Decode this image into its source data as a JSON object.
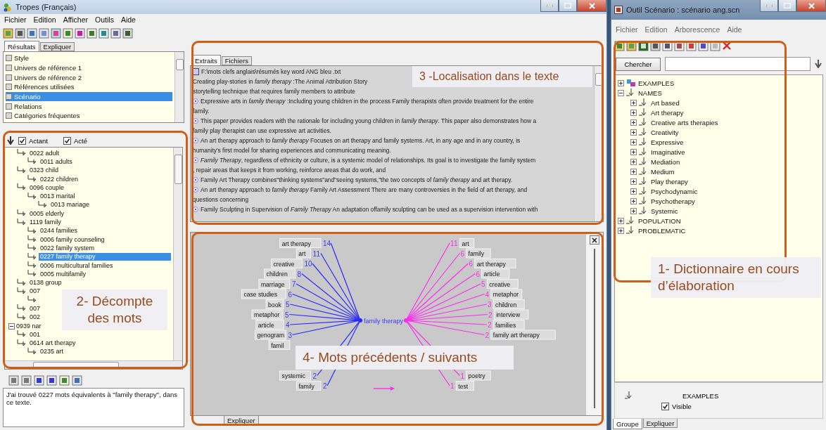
{
  "left_window": {
    "title": "Tropes (Français)",
    "menu": [
      "Fichier",
      "Edition",
      "Afficher",
      "Outils",
      "Aide"
    ],
    "results_tabs": [
      {
        "label": "Résultats",
        "selected": true
      },
      {
        "label": "Expliquer",
        "selected": false
      }
    ],
    "results_list": [
      {
        "label": "Style",
        "selected": false
      },
      {
        "label": "Univers de référence 1",
        "selected": false
      },
      {
        "label": "Univers de référence 2",
        "selected": false
      },
      {
        "label": "Références utilisées",
        "selected": false
      },
      {
        "label": "Scénario",
        "selected": true
      },
      {
        "label": "Relations",
        "selected": false
      },
      {
        "label": "Catégories fréquentes",
        "selected": false
      }
    ],
    "filters": [
      {
        "label": "Actant",
        "checked": true
      },
      {
        "label": "Acté",
        "checked": true
      }
    ],
    "tree": [
      {
        "children": [
          {
            "label": "0022 adult",
            "selected": false,
            "children": [
              {
                "label": "0011 adults",
                "selected": false
              }
            ]
          },
          {
            "label": "0323 child",
            "selected": false,
            "children": [
              {
                "label": "0222 children",
                "selected": false
              }
            ]
          },
          {
            "label": "0096 couple",
            "selected": false,
            "children": [
              {
                "label": "0013 marital",
                "selected": false,
                "children": [
                  {
                    "label": "0013 mariage",
                    "selected": false
                  }
                ]
              }
            ]
          },
          {
            "label": "0005 elderly",
            "selected": false
          },
          {
            "label": "1119 family",
            "selected": false,
            "children": [
              {
                "label": "0244 families",
                "selected": false
              },
              {
                "label": "0006 family counseling",
                "selected": false
              },
              {
                "label": "0022 family system",
                "selected": false
              },
              {
                "label": "0227 family therapy",
                "selected": true
              },
              {
                "label": "0006 multicultural families",
                "selected": false
              },
              {
                "label": "0005 multifamily",
                "selected": false
              }
            ]
          },
          {
            "label": "0138 group",
            "selected": false
          },
          {
            "label": "007",
            "selected": false,
            "children": [
              {
                "kind": "branch"
              }
            ]
          },
          {
            "label": "007",
            "selected": false
          },
          {
            "label": "002",
            "selected": false
          }
        ]
      },
      {
        "label": "0939 nar",
        "selected": false,
        "children": [
          {
            "label": "001",
            "selected": false
          },
          {
            "label": "0614 art therapy",
            "selected": false,
            "children": [
              {
                "label": "0235 art",
                "selected": false
              }
            ]
          }
        ]
      }
    ],
    "message": "J'ai trouvé 0227 mots équivalents à \"family therapy\", dans ce texte.",
    "text_tabs": [
      {
        "label": "Extraits",
        "selected": true
      },
      {
        "label": "Fichiers",
        "selected": false
      }
    ],
    "extract_lines": [
      {
        "kind": "file",
        "text": "F:\\mots clefs anglais\\résumés key word ANG bleu .txt"
      },
      {
        "kind": "plain",
        "text": "Creating play-stories in *family therapy* :The Animal Attribution Story"
      },
      {
        "kind": "plain",
        "text": "storytelling technique that requires family members to attribute"
      },
      {
        "kind": "bullet",
        "text": "Expressive arts in *family therapy* :Including young children in the process Family therapists often provide treatment for the entire"
      },
      {
        "kind": "plain",
        "text": "family."
      },
      {
        "kind": "bullet",
        "text": "This paper provides readers with the rationale for including young children in *family therapy*. This paper also demonstrates how a"
      },
      {
        "kind": "plain",
        "text": "family play therapist can use expressive art activities."
      },
      {
        "kind": "bullet",
        "text": "An art therapy approach to *family therapy* Focuses on art therapy and family systems. Art, in any age and in any country, is"
      },
      {
        "kind": "plain",
        "text": "humanity's first model for sharing experiences and communicating meaning."
      },
      {
        "kind": "bullet",
        "text": "*Family Therapy*, regardless of ethnicity or culture, is a systemic model of relationships. Its goal is to investigate the family system"
      },
      {
        "kind": "plain",
        "text": ", repair areas that keeps it from working, reinforce areas that do work, and"
      },
      {
        "kind": "bullet",
        "text": "Family Art Therapy combines\"thinking systems\"and\"seeing systems,\"the two concepts of *family therapy* and art therapy."
      },
      {
        "kind": "bullet",
        "text": "An art therapy approach to *family therapy* Family Art Assessment There are many controversies in the field of art therapy, and"
      },
      {
        "kind": "plain",
        "text": "questions concerning"
      },
      {
        "kind": "bullet",
        "text": "Family Sculpting in Supervision of *Family Therapy* An adaptation offamily sculpting can be used as a supervision intervention with"
      }
    ],
    "graph": {
      "center": "family therapy",
      "before": [
        {
          "word": "art therapy",
          "count": "14"
        },
        {
          "word": "art",
          "count": "11"
        },
        {
          "word": "creative",
          "count": "10"
        },
        {
          "word": "children",
          "count": "8"
        },
        {
          "word": "marriage",
          "count": "7"
        },
        {
          "word": "case studies",
          "count": "6"
        },
        {
          "word": "book",
          "count": "5"
        },
        {
          "word": "metaphor",
          "count": "5"
        },
        {
          "word": "article",
          "count": "4"
        },
        {
          "word": "genogram",
          "count": "3"
        },
        {
          "word": "famil"
        }
      ],
      "before_tail": [
        {
          "word": "systemic",
          "count": "2"
        },
        {
          "word": "family",
          "count": "2"
        }
      ],
      "after": [
        {
          "word": "art",
          "count": "11"
        },
        {
          "word": "family",
          "count": "6"
        },
        {
          "word": "art therapy",
          "count": "6"
        },
        {
          "word": "article",
          "count": "6"
        },
        {
          "word": "creative",
          "count": "5"
        },
        {
          "word": "metaphor",
          "count": "4"
        },
        {
          "word": "children",
          "count": "3"
        },
        {
          "word": "interview",
          "count": "2"
        },
        {
          "word": "families",
          "count": "2"
        },
        {
          "word": "family art therapy",
          "count": "2"
        }
      ],
      "after_tail": [
        {
          "word": "poetry",
          "count": "1"
        },
        {
          "word": "test",
          "count": "1"
        }
      ]
    },
    "graph_tabs": [
      {
        "label": "Expliquer",
        "selected": false
      }
    ]
  },
  "right_window": {
    "title": "Outil Scénario : scénario ang.scn",
    "menu": [
      "Fichier",
      "Edition",
      "Arborescence",
      "Aide"
    ],
    "search_button": "Chercher",
    "tree": [
      {
        "label": "EXAMPLES",
        "kind": "examples",
        "expanded": false
      },
      {
        "label": "NAMES",
        "kind": "category",
        "expanded": true,
        "children": [
          {
            "label": "Art based",
            "kind": "category",
            "expanded": false
          },
          {
            "label": "Art therapy",
            "kind": "category",
            "expanded": false
          },
          {
            "label": "Creative arts therapies",
            "kind": "category",
            "expanded": false
          },
          {
            "label": "Creativity",
            "kind": "category",
            "expanded": false
          },
          {
            "label": "Expressive",
            "kind": "category",
            "expanded": false
          },
          {
            "label": "Imaginative",
            "kind": "category",
            "expanded": false
          },
          {
            "label": "Mediation",
            "kind": "category",
            "expanded": false
          },
          {
            "label": "Medium",
            "kind": "category",
            "expanded": false
          },
          {
            "label": "Play therapy",
            "kind": "category",
            "expanded": false
          },
          {
            "label": "Psychodynamic",
            "kind": "category",
            "expanded": false
          },
          {
            "label": "Psychotherapy",
            "kind": "category",
            "expanded": false
          },
          {
            "label": "Systemic",
            "kind": "category",
            "expanded": false
          }
        ]
      },
      {
        "label": "POPULATION",
        "kind": "category",
        "expanded": false
      },
      {
        "label": "PROBLEMATIC",
        "kind": "category",
        "expanded": false
      }
    ],
    "detail": {
      "label": "EXAMPLES",
      "visible": {
        "label": "Visible",
        "checked": true
      }
    },
    "tabs": [
      {
        "label": "Groupe",
        "selected": true
      },
      {
        "label": "Expliquer",
        "selected": false
      }
    ]
  },
  "annotations": [
    {
      "text": "1- Dictionnaire en cours d’élaboration"
    },
    {
      "text": "2- Décompte des mots"
    },
    {
      "text": "3 -Localisation dans le texte"
    },
    {
      "text": "4- Mots précédents / suivants"
    }
  ]
}
